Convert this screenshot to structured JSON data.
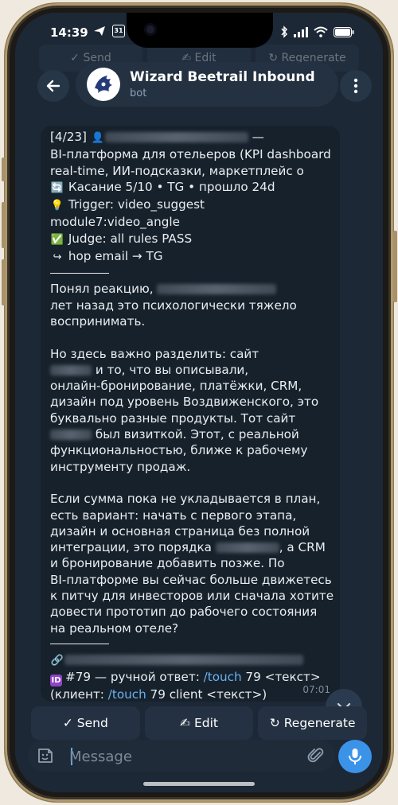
{
  "status_bar": {
    "time": "14:39",
    "left_icons": [
      "telegram-send-icon",
      "calendar-icon"
    ],
    "calendar_day": "31",
    "right_icons": [
      "bluetooth-icon",
      "signal-icon",
      "wifi-icon",
      "battery-icon"
    ]
  },
  "ghost_buttons": [
    "✓ Send",
    "✍ Edit",
    "↻ Regenerate"
  ],
  "header": {
    "title": "Wizard Beetrail Inbound",
    "subtitle": "bot",
    "back_icon": "arrow-left-icon",
    "menu_icon": "more-vertical-icon"
  },
  "message": {
    "lines": [
      {
        "type": "text",
        "parts": [
          {
            "t": "[4/23] "
          },
          {
            "emoji": "bust-icon",
            "char": "👤"
          },
          {
            "blur": 180
          },
          {
            "t": " —"
          }
        ]
      },
      {
        "type": "text",
        "parts": [
          {
            "t": "BI-платформа для отельеров (KPI dashboard"
          }
        ]
      },
      {
        "type": "text",
        "parts": [
          {
            "t": "real-time, ИИ-подсказки, маркетплейс о"
          }
        ]
      },
      {
        "type": "text",
        "parts": [
          {
            "emoji": "repeat-icon",
            "char": "🔄"
          },
          {
            "t": " Касание 5/10 • TG • прошло 24d"
          }
        ]
      },
      {
        "type": "text",
        "parts": [
          {
            "emoji": "lightbulb-icon",
            "char": "💡"
          },
          {
            "t": " Trigger: video_suggest"
          }
        ]
      },
      {
        "type": "text",
        "parts": [
          {
            "t": "module7:video_angle"
          }
        ]
      },
      {
        "type": "text",
        "parts": [
          {
            "emoji": "check-icon",
            "char": "✅"
          },
          {
            "t": " Judge: all rules PASS"
          }
        ]
      },
      {
        "type": "text",
        "parts": [
          {
            "emoji": "hop-arrow-icon",
            "char": "↪"
          },
          {
            "t": " hop email → TG"
          }
        ]
      },
      {
        "type": "rule"
      },
      {
        "type": "text",
        "parts": [
          {
            "t": "Понял реакцию, "
          },
          {
            "blur": 150
          }
        ]
      },
      {
        "type": "text",
        "parts": [
          {
            "t": "лет назад это психологически тяжело"
          }
        ]
      },
      {
        "type": "text",
        "parts": [
          {
            "t": "воспринимать."
          }
        ]
      },
      {
        "type": "blank"
      },
      {
        "type": "text",
        "parts": [
          {
            "t": "Но здесь важно разделить: сайт"
          }
        ]
      },
      {
        "type": "text",
        "parts": [
          {
            "blur": 52
          },
          {
            "t": " и то, что вы описывали,"
          }
        ]
      },
      {
        "type": "text",
        "parts": [
          {
            "t": "онлайн-бронирование, платёжки, CRM,"
          }
        ]
      },
      {
        "type": "text",
        "parts": [
          {
            "t": "дизайн под уровень Воздвиженского, это"
          }
        ]
      },
      {
        "type": "text",
        "parts": [
          {
            "t": "буквально разные продукты. Тот сайт"
          }
        ]
      },
      {
        "type": "text",
        "parts": [
          {
            "blur": 52
          },
          {
            "t": " был визиткой. Этот, с реальной"
          }
        ]
      },
      {
        "type": "text",
        "parts": [
          {
            "t": "функциональностью, ближе к рабочему"
          }
        ]
      },
      {
        "type": "text",
        "parts": [
          {
            "t": "инструменту продаж."
          }
        ]
      },
      {
        "type": "blank"
      },
      {
        "type": "text",
        "parts": [
          {
            "t": "Если сумма пока не укладывается в план,"
          }
        ]
      },
      {
        "type": "text",
        "parts": [
          {
            "t": "есть вариант: начать с первого этапа,"
          }
        ]
      },
      {
        "type": "text",
        "parts": [
          {
            "t": "дизайн и основная страница без полной"
          }
        ]
      },
      {
        "type": "text",
        "parts": [
          {
            "t": "интеграции, это порядка "
          },
          {
            "blur": 80
          },
          {
            "t": ", а CRM"
          }
        ]
      },
      {
        "type": "text",
        "parts": [
          {
            "t": "и бронирование добавить позже. По"
          }
        ]
      },
      {
        "type": "text",
        "parts": [
          {
            "t": "BI-платформе вы сейчас больше движетесь"
          }
        ]
      },
      {
        "type": "text",
        "parts": [
          {
            "t": "к питчу для инвесторов или сначала хотите"
          }
        ]
      },
      {
        "type": "text",
        "parts": [
          {
            "t": "довести прототип до рабочего состояния"
          }
        ]
      },
      {
        "type": "text",
        "parts": [
          {
            "t": "на реальном отеле?"
          }
        ]
      },
      {
        "type": "rule"
      },
      {
        "type": "text",
        "parts": [
          {
            "emoji": "link-icon",
            "char": "🔗"
          },
          {
            "blur": 300
          }
        ]
      },
      {
        "type": "text",
        "parts": [
          {
            "emoji": "id-icon",
            "box": "ID",
            "color": "#8e44c6"
          },
          {
            "t": "#79 — ручной ответ: "
          },
          {
            "cmd": "/touch"
          },
          {
            "t": " 79 <текст>"
          }
        ]
      },
      {
        "type": "text",
        "parts": [
          {
            "t": "(клиент: "
          },
          {
            "cmd": "/touch"
          },
          {
            "t": " 79 client <текст>)"
          }
        ]
      }
    ],
    "time": "07:01"
  },
  "keyboard": {
    "send": "✓ Send",
    "edit": "✍ Edit",
    "regenerate": "↻ Regenerate"
  },
  "input": {
    "placeholder": "Message",
    "sticker_icon": "sticker-icon",
    "attach_icon": "paperclip-icon",
    "mic_icon": "microphone-icon"
  },
  "colors": {
    "background": "#1c2836",
    "bubble": "#17212b",
    "accent": "#3b93e8",
    "command": "#6ab2f2"
  }
}
